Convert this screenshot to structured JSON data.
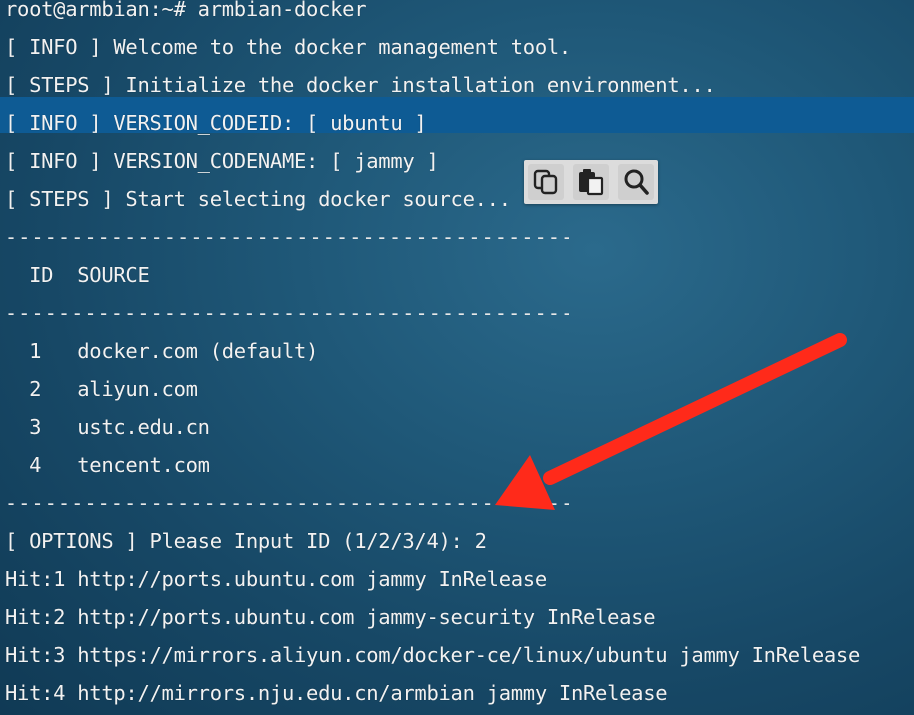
{
  "terminal": {
    "prompt": "root@armbian:~# armbian-docker",
    "info_welcome": "[ INFO ] Welcome to the docker management tool.",
    "steps_init": "[ STEPS ] Initialize the docker installation environment...",
    "info_codeid": "[ INFO ] VERSION_CODEID: [ ubuntu ]",
    "info_codename": "[ INFO ] VERSION_CODENAME: [ jammy ]",
    "steps_select": "[ STEPS ] Start selecting docker source...",
    "separator": "-------------------------------------------------------------------------------------",
    "table_header": "  ID  SOURCE",
    "sources": [
      "  1   docker.com (default)",
      "  2   aliyun.com",
      "  3   ustc.edu.cn",
      "  4   tencent.com"
    ],
    "options_prompt": "[ OPTIONS ] Please Input ID (1/2/3/4): 2",
    "hits": [
      "Hit:1 http://ports.ubuntu.com jammy InRelease",
      "Hit:2 http://ports.ubuntu.com jammy-security InRelease",
      "Hit:3 https://mirrors.aliyun.com/docker-ce/linux/ubuntu jammy InRelease",
      "Hit:4 http://mirrors.nju.edu.cn/armbian jammy InRelease"
    ]
  },
  "toolbar": {
    "icons": [
      "copy-icon",
      "paste-icon",
      "search-icon"
    ]
  },
  "colors": {
    "highlight": "#0e5b94",
    "arrow": "#ff2a1a",
    "text": "#f2f2f2"
  }
}
